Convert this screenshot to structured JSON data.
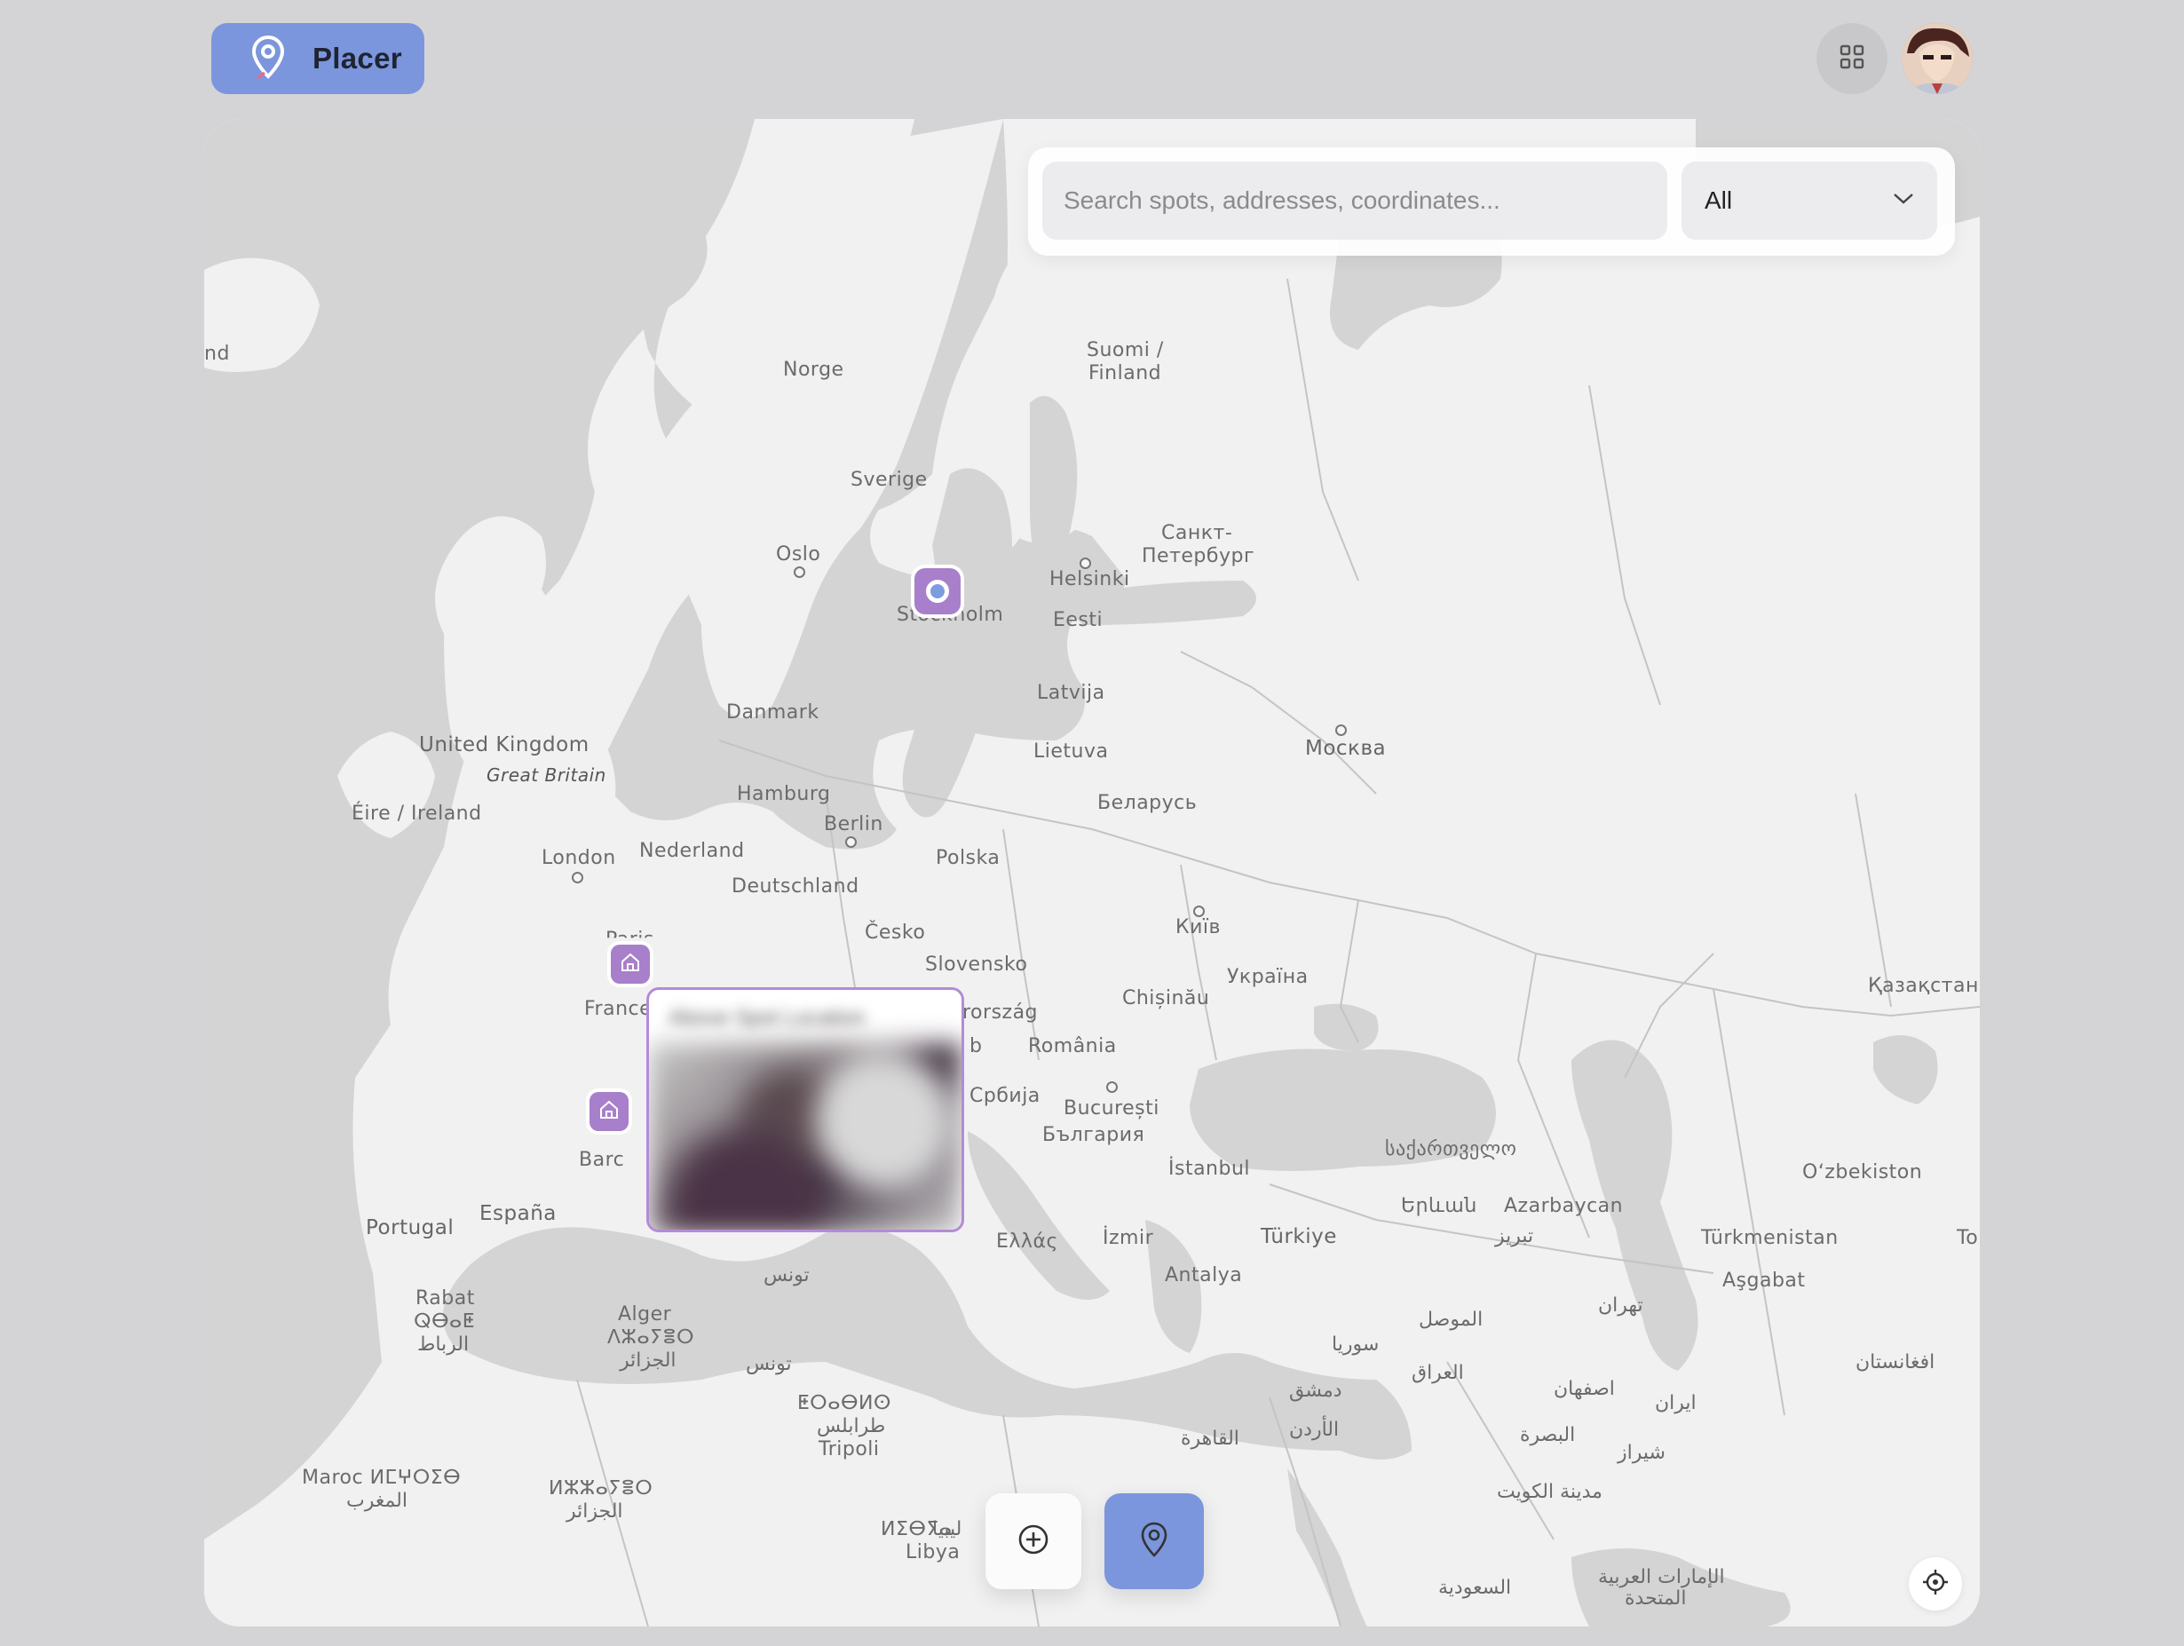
{
  "app": {
    "name": "Placer",
    "accent": "#7b96dc",
    "marker_color": "#a87fca"
  },
  "header": {
    "logo_icon": "map-pin-icon",
    "apps_icon": "grid-icon",
    "avatar_alt": "avatar"
  },
  "search": {
    "placeholder": "Search spots, addresses, coordinates...",
    "value": "",
    "filter_selected": "All"
  },
  "map": {
    "labels": {
      "iceland": "nd",
      "norge": "Norge",
      "sverige": "Sverige",
      "suomi": "Suomi /",
      "finland": "Finland",
      "oslo": "Oslo",
      "stockholm": "Stockholm",
      "helsinki": "Helsinki",
      "spb1": "Санкт-",
      "spb2": "Петербург",
      "eesti": "Eesti",
      "latvija": "Latvija",
      "danmark": "Danmark",
      "lietuva": "Lietuva",
      "moskva": "Москва",
      "uk": "United Kingdom",
      "gb": "Great Britain",
      "ireland": "Éire / Ireland",
      "hamburg": "Hamburg",
      "berlin": "Berlin",
      "belarus": "Беларусь",
      "london": "London",
      "nederland": "Nederland",
      "polska": "Polska",
      "deutschland": "Deutschland",
      "paris": "Paris",
      "cesko": "Česko",
      "kyiv": "Київ",
      "slovensko": "Slovensko",
      "ukraina": "Україна",
      "chisinau": "Chișinău",
      "kazakhstan": "Қазақстан",
      "france": "France",
      "orszag": "rország",
      "romania": "România",
      "b": "b",
      "srbija": "Србија",
      "bucuresti": "București",
      "bulgaria": "България",
      "barcelona": "Barc",
      "istanbul": "İstanbul",
      "georgia": "საქართველო",
      "uzbekistan": "O‘zbekiston",
      "yerevan": "Երևան",
      "azerbaycan": "Azarbaycan",
      "tabriz": "تبریز",
      "portugal": "Portugal",
      "espana": "España",
      "ellas": "Ελλάς",
      "izmir": "İzmir",
      "turkiye": "Türkiye",
      "turkmenistan": "Türkmenistan",
      "to": "To",
      "ashgabat": "Aşgabat",
      "tunis_ar": "تونس",
      "antalya": "Antalya",
      "rabat": "Rabat",
      "rabat_tf": "ⵕⴱⴰⵟ",
      "rabat_ar": "الرباط",
      "alger": "Alger",
      "alger_tf": "ⴷⵣⴰⵢⴻⵔ",
      "alger_ar": "الجزائر",
      "tunis_ar2": "تونس",
      "mosul": "الموصل",
      "tehran": "تهران",
      "suria": "سوريا",
      "afghanistan": "افغانستان",
      "iraq": "العراق",
      "isfahan": "اصفهان",
      "iran": "ایران",
      "dimashq": "دمشق",
      "urdun": "الأردن",
      "tripoli_tf": "ⵟⵔⴰⴱⵍⵙ",
      "tripoli_ar": "طرابلس",
      "tripoli": "Tripoli",
      "qahira": "القاهرة",
      "basra": "البصرة",
      "shiraz": "شیراز",
      "maroc": "Maroc ⵍⵎⵖⵔⵉⴱ",
      "maghrib": "المغرب",
      "dzayer_tf": "ⵍⵣⵣⴰⵢⴻⵔ",
      "dzayer_ar": "الجزائر",
      "kuwait": "مدينة الكويت",
      "libya_tf": "ⵍⵉⴱⵢⴰ",
      "libya_ar": "ليبيا",
      "libya": "Libya",
      "saudi": "السعودية",
      "uae1": "الإمارات العربية",
      "uae2": "المتحدة"
    },
    "popup": {
      "title": "Above Spot Location"
    }
  },
  "controls": {
    "add_icon": "plus-circle-icon",
    "pin_icon": "map-pin-icon",
    "locate_icon": "crosshair-icon"
  }
}
